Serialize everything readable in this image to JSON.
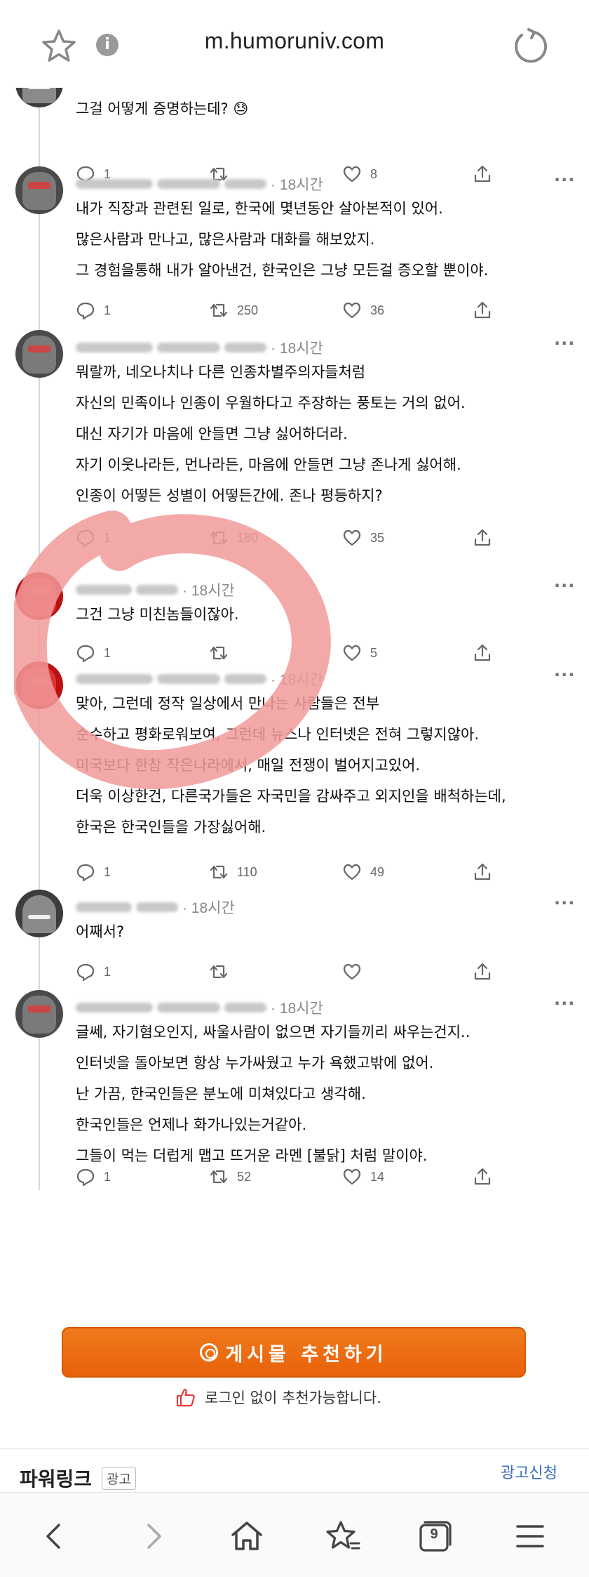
{
  "browser": {
    "url": "m.humoruniv.com",
    "tab_count": "9"
  },
  "tweets": [
    {
      "time": "",
      "lines": [
        "그걸 어떻게 증명하는데? 😓"
      ],
      "reply": "1",
      "retweet": "",
      "like": "8"
    },
    {
      "time": "· 18시간",
      "lines": [
        "내가 직장과 관련된 일로, 한국에 몇년동안 살아본적이 있어.",
        "많은사람과 만나고, 많은사람과 대화를 해보았지.",
        "그 경험을통해 내가 알아낸건, 한국인은 그냥 모든걸 증오할 뿐이야."
      ],
      "reply": "1",
      "retweet": "250",
      "like": "36"
    },
    {
      "time": "· 18시간",
      "lines": [
        "뭐랄까, 네오나치나 다른 인종차별주의자들처럼",
        "자신의 민족이나 인종이 우월하다고 주장하는 풍토는 거의 없어.",
        "대신 자기가 마음에 안들면 그냥 싫어하더라.",
        "자기 이웃나라든, 먼나라든, 마음에 안들면 그냥 존나게 싫어해.",
        "인종이 어떻든 성별이 어떻든간에. 존나 평등하지?"
      ],
      "reply": "1",
      "retweet": "180",
      "like": "35"
    },
    {
      "time": "· 18시간",
      "lines": [
        "그건 그냥 미친놈들이잖아."
      ],
      "reply": "1",
      "retweet": "",
      "like": "5"
    },
    {
      "time": "· 18시간",
      "lines": [
        "맞아, 그런데 정작 일상에서 만나는 사람들은 전부",
        "순수하고 평화로워보여, 그런데 뉴스나 인터넷은 전혀 그렇지않아.",
        "미국보다 한참 작은나라에서, 매일 전쟁이 벌어지고있어.",
        "더욱 이상한건, 다른국가들은 자국민을 감싸주고 외지인을 배척하는데,",
        "한국은 한국인들을 가장싫어해."
      ],
      "reply": "1",
      "retweet": "110",
      "like": "49"
    },
    {
      "time": "· 18시간",
      "lines": [
        "어째서?"
      ],
      "reply": "1",
      "retweet": "",
      "like": ""
    },
    {
      "time": "· 18시간",
      "lines": [
        "글쎄, 자기혐오인지, 싸울사람이 없으면 자기들끼리 싸우는건지..",
        "인터넷을 돌아보면 항상 누가싸웠고 누가 욕했고밖에 없어.",
        "난 가끔, 한국인들은 분노에 미쳐있다고 생각해.",
        "한국인들은 언제나 화가나있는거같아.",
        "그들이 먹는 더럽게 맵고 뜨거운 라멘 [불닭] 처럼 말이야."
      ],
      "reply": "1",
      "retweet": "52",
      "like": "14"
    }
  ],
  "recommend": {
    "button_label": "게시물 추천하기",
    "note": "로그인 없이 추천가능합니다."
  },
  "powerlink": {
    "title": "파워링크",
    "badge": "광고",
    "apply": "광고신청"
  },
  "colors": {
    "accent_orange": "#e8610a",
    "link_blue": "#3c6fbf",
    "annotation_red": "#f08a8a"
  }
}
